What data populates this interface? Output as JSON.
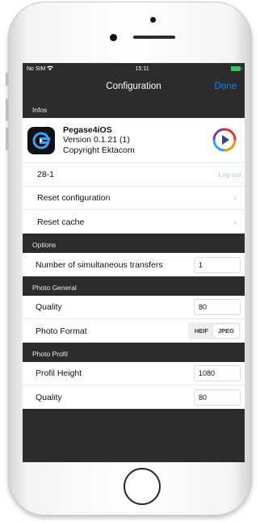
{
  "status": {
    "carrier": "No SIM",
    "time": "15:11"
  },
  "nav": {
    "title": "Configuration",
    "done": "Done"
  },
  "sections": {
    "infos": "Infos",
    "options": "Options",
    "photo_general": "Photo General",
    "photo_profil": "Photo Profil"
  },
  "app": {
    "name": "Pegase4iOS",
    "version": "Version 0.1.21 (1)",
    "copyright": "Copyright Ektacom"
  },
  "account": {
    "id": "28-1",
    "logout": "Log out"
  },
  "actions": {
    "reset_config": "Reset configuration",
    "reset_cache": "Reset cache"
  },
  "options": {
    "transfers_label": "Number of simultaneous transfers",
    "transfers_value": "1"
  },
  "photo_general": {
    "quality_label": "Quality",
    "quality_value": "80",
    "format_label": "Photo Format",
    "format_options": [
      "HEIF",
      "JPEG"
    ],
    "format_selected": "JPEG"
  },
  "photo_profil": {
    "height_label": "Profil Height",
    "height_value": "1080",
    "quality_label": "Quality",
    "quality_value": "80"
  },
  "colors": {
    "accent": "#0a84ff",
    "background": "#2c2c2e",
    "battery": "#34c759"
  }
}
